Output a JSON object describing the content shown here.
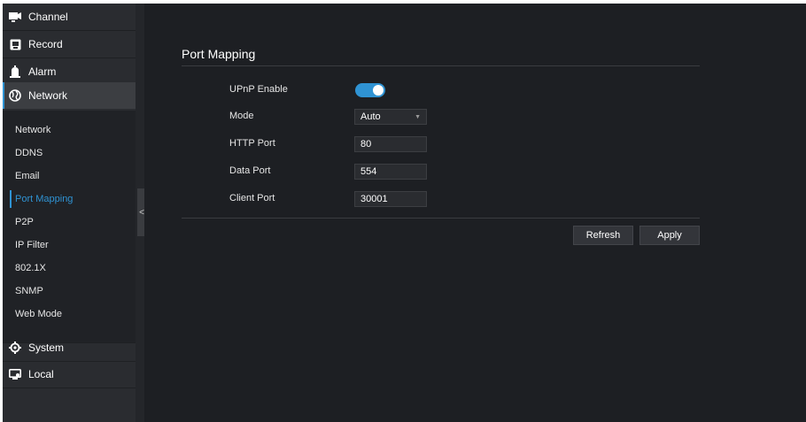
{
  "sidebar": {
    "items": [
      {
        "label": "Channel",
        "icon": "channel-icon"
      },
      {
        "label": "Record",
        "icon": "record-icon"
      },
      {
        "label": "Alarm",
        "icon": "alarm-icon"
      },
      {
        "label": "Network",
        "icon": "globe-icon"
      },
      {
        "label": "System",
        "icon": "gear-icon"
      },
      {
        "label": "Local",
        "icon": "local-icon"
      }
    ],
    "active_item": "Network",
    "subitems": [
      "Network",
      "DDNS",
      "Email",
      "Port Mapping",
      "P2P",
      "IP Filter",
      "802.1X",
      "SNMP",
      "Web Mode"
    ],
    "active_subitem": "Port Mapping",
    "collapse_glyph": "<"
  },
  "main": {
    "title": "Port Mapping",
    "form": {
      "upnp_label": "UPnP Enable",
      "upnp_enabled": true,
      "mode_label": "Mode",
      "mode_value": "Auto",
      "http_label": "HTTP Port",
      "http_value": "80",
      "data_label": "Data Port",
      "data_value": "554",
      "client_label": "Client Port",
      "client_value": "30001"
    },
    "buttons": {
      "refresh": "Refresh",
      "apply": "Apply"
    }
  },
  "colors": {
    "accent": "#2f93d3",
    "background": "#1d1f23",
    "sidebar": "#2a2c30"
  }
}
